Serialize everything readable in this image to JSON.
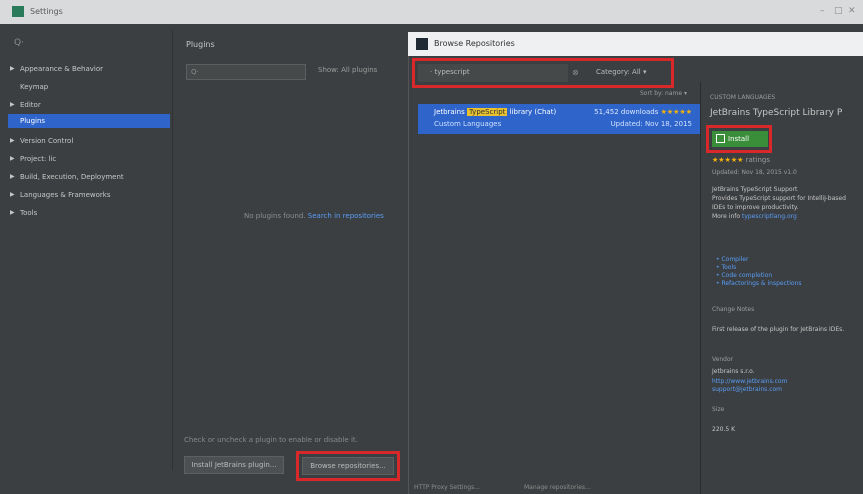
{
  "window": {
    "title": "Settings",
    "controls": [
      "–",
      "□",
      "✕"
    ]
  },
  "settings_tree": {
    "search_placeholder": "Q·",
    "items": [
      {
        "label": "Appearance & Behavior",
        "arrow": "▶"
      },
      {
        "label": "Keymap",
        "arrow": ""
      },
      {
        "label": "Editor",
        "arrow": "▶"
      },
      {
        "label": "Plugins",
        "arrow": ""
      },
      {
        "label": "Version Control",
        "arrow": "▶"
      },
      {
        "label": "Project: lic",
        "arrow": "▶"
      },
      {
        "label": "Build, Execution, Deployment",
        "arrow": "▶"
      },
      {
        "label": "Languages & Frameworks",
        "arrow": "▶"
      },
      {
        "label": "Tools",
        "arrow": "▶"
      }
    ]
  },
  "plugins": {
    "header": "Plugins",
    "search_placeholder": "Q·",
    "show_label": "Show:",
    "show_value": "All plugins",
    "no_plugins_text": "No plugins found.",
    "no_plugins_link": "Search in repositories",
    "bottom_hint": "Check or uncheck a plugin to enable or disable it.",
    "install_jetbrains_label": "Install JetBrains plugin...",
    "browse_repos_label": "Browse repositories..."
  },
  "dialog": {
    "title": "Browse Repositories",
    "search_value": "· typescript",
    "category_label": "Category: All",
    "sort_label": "Sort by: name ▾",
    "row": {
      "name_prefix": "Jetbrains",
      "name_tag": "TypeScript",
      "name_suffix": "library (Chat)",
      "category": "Custom Languages",
      "downloads": "51,452 downloads",
      "stars": "★★★★★",
      "updated": "Updated: Nov 18, 2015"
    },
    "detail": {
      "category": "CUSTOM LANGUAGES",
      "name": "JetBrains TypeScript Library P",
      "install_label": "Install",
      "stars": "★★★★★",
      "ratings": "ratings",
      "updated": "Updated: Nov 18, 2015  v1.0",
      "desc_title": "JetBrains TypeScript Support",
      "desc_body": "Provides TypeScript support for IntelliJ-based IDEs to improve productivity.",
      "desc_more": "More info",
      "desc_link": "typescriptlang.org",
      "bullets": [
        "Compiler",
        "Tools",
        "Code completion",
        "Refactorings & inspections"
      ],
      "change_notes_title": "Change Notes",
      "change_notes_body": "First release of the plugin for JetBrains IDEs.",
      "vendor_title": "Vendor",
      "vendor_name": "Jetbrains s.r.o.",
      "vendor_link1": "http://www.jetbrains.com",
      "vendor_link2": "support@jetbrains.com",
      "size_title": "Size",
      "size_value": "220.5 K"
    },
    "http_proxy_label": "HTTP Proxy Settings...",
    "manage_repos_label": "Manage repositories..."
  }
}
